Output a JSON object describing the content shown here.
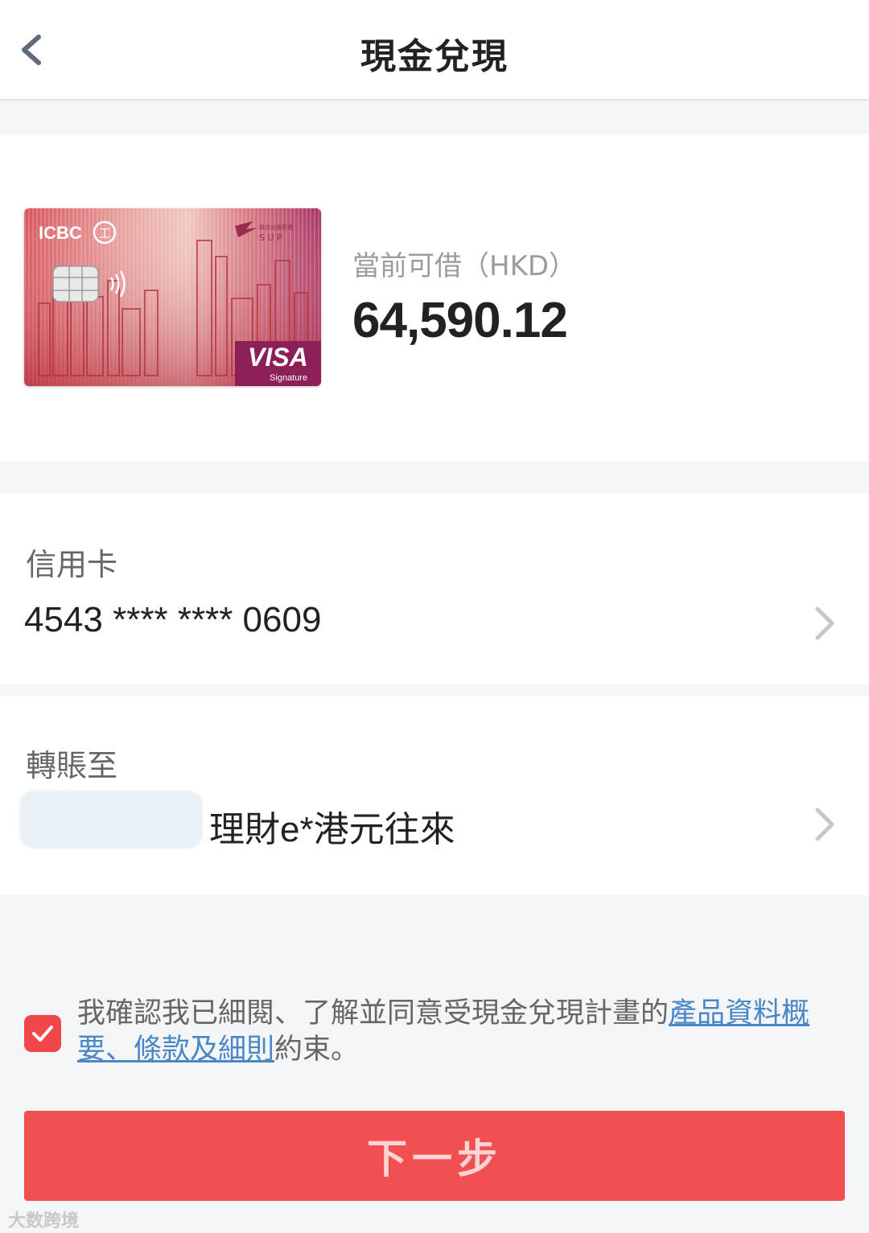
{
  "nav": {
    "title": "現金兌現"
  },
  "card": {
    "bank_logo": "ICBC",
    "bank_seal": "工",
    "partner_logo_text": "聯合出版集團",
    "partner_logo_sub": "S U P",
    "network": "VISA",
    "network_tier": "Signature"
  },
  "available": {
    "label": "當前可借（HKD）",
    "amount": "64,590.12"
  },
  "credit": {
    "label": "信用卡",
    "value": "4543 **** **** 0609"
  },
  "transfer": {
    "label": "轉賬至",
    "value": "理財e*港元往來"
  },
  "agreement": {
    "checked": true,
    "text_before": "我確認我已細閱、了解並同意受現金兌現計畫的",
    "link": "產品資料概要、條款及細則",
    "text_after": "約束。"
  },
  "next_button": "下一步",
  "watermark": "大数跨境",
  "colors": {
    "accent": "#f15052",
    "link": "#4a86c8"
  }
}
